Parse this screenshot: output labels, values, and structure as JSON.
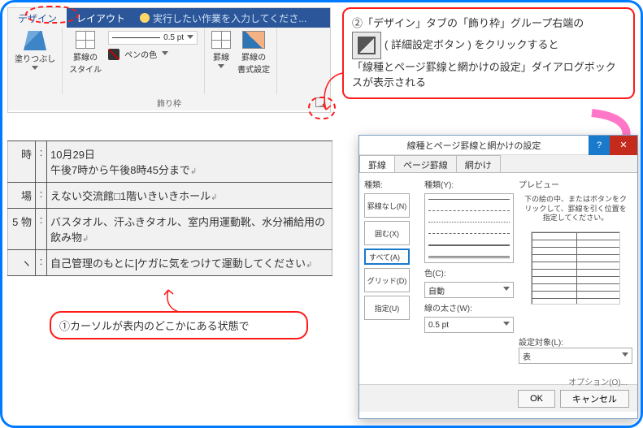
{
  "ribbon": {
    "tabs": {
      "design": "デザイン",
      "layout": "レイアウト",
      "tell": "実行したい作業を入力してくださ..."
    },
    "fill": "塗りつぶし",
    "border_style": "罫線の\nスタイル",
    "pt": "0.5 pt",
    "pen_color": "ペンの色",
    "border": "罫線",
    "border_fmt": "罫線の\n書式設定",
    "group": "飾り枠"
  },
  "callout": {
    "l1": "②「デザイン」タブの「飾り枠」グループ右端の",
    "l2": "( 詳細設定ボタン ) をクリックすると",
    "l3": "「線種とページ罫線と網かけの設定」ダイアログボックスが表示される"
  },
  "table": {
    "r1": {
      "h": "時",
      "c": ":",
      "t": "10月29日\n午後7時から午後8時45分まで"
    },
    "r2": {
      "h": "場",
      "c": ":",
      "t": "えない交流館□1階いきいきホール"
    },
    "r3": {
      "h": "5 物",
      "c": ":",
      "t": "バスタオル、汗ふきタオル、室内用運動靴、水分補給用の飲み物"
    },
    "r4": {
      "h": "ヽ",
      "c": ":",
      "ta": "自己管理のもとに",
      "tb": "ケガに気をつけて運動してください"
    }
  },
  "callout2": "①カーソルが表内のどこかにある状態で",
  "dialog": {
    "title": "線種とページ罫線と網かけの設定",
    "tabs": {
      "a": "罫線",
      "b": "ページ罫線",
      "c": "網かけ"
    },
    "left_label": "種類:",
    "presets": {
      "none": "罫線なし(N)",
      "box": "囲む(X)",
      "all": "すべて(A)",
      "grid": "グリッド(D)",
      "custom": "指定(U)"
    },
    "mid": {
      "style": "種類(Y):",
      "color": "色(C):",
      "color_v": "自動",
      "width": "線の太さ(W):",
      "width_v": "0.5 pt"
    },
    "right": {
      "head": "プレビュー",
      "note": "下の絵の中、またはボタンをクリックして、罫線を引く位置を指定してください。",
      "target": "設定対象(L):",
      "target_v": "表"
    },
    "opt": "オプション(O)...",
    "ok": "OK",
    "cancel": "キャンセル"
  }
}
